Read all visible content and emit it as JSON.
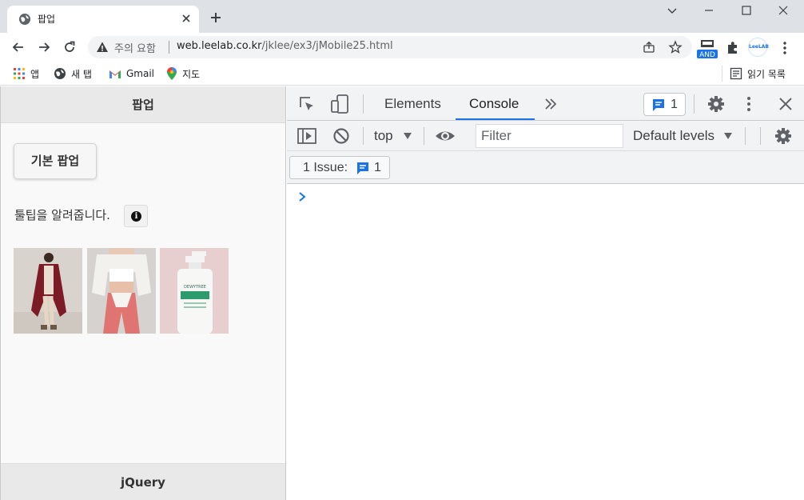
{
  "browser": {
    "tab": {
      "title": "팝업",
      "favicon": "globe-icon"
    },
    "window_controls": [
      "chevron-down-icon",
      "minimize-icon",
      "maximize-icon",
      "close-icon"
    ],
    "address_bar": {
      "security_label": "주의 요함",
      "url_host": "web.leelab.co.kr",
      "url_path": "/jklee/ex3/jMobile25.html"
    },
    "extensions": {
      "and_label": "AND",
      "leelab_label": "LeeLAB"
    },
    "bookmarks": [
      {
        "label": "앱",
        "icon": "apps-grid-icon"
      },
      {
        "label": "새 탭",
        "icon": "globe-icon"
      },
      {
        "label": "Gmail",
        "icon": "gmail-icon"
      },
      {
        "label": "지도",
        "icon": "maps-pin-icon"
      }
    ],
    "reading_list_label": "읽기 목록"
  },
  "page": {
    "header_title": "팝업",
    "popup_button_label": "기본 팝업",
    "tooltip_text": "툴팁을 알려줍니다.",
    "info_icon_glyph": "i",
    "footer_title": "jQuery",
    "thumbnails": [
      {
        "name": "red-coat-model",
        "bg": "#d8d2cc",
        "accent": "#7c1a26"
      },
      {
        "name": "white-top-model",
        "bg": "#d7d4d2",
        "accent": "#e07470"
      },
      {
        "name": "dewytree-shampoo",
        "bg": "#e8cfcf",
        "accent": "#2e9b6e"
      }
    ],
    "thumbnail_product_label": "DEWYTREE"
  },
  "devtools": {
    "tabs": [
      {
        "label": "Elements",
        "active": false
      },
      {
        "label": "Console",
        "active": true
      }
    ],
    "issue_count": "1",
    "context": "top",
    "filter_placeholder": "Filter",
    "levels_label": "Default levels",
    "issues_label": "1 Issue:",
    "issues_count": "1",
    "colors": {
      "accent": "#1a73e8",
      "toolbar_bg": "#f1f3f4"
    }
  }
}
